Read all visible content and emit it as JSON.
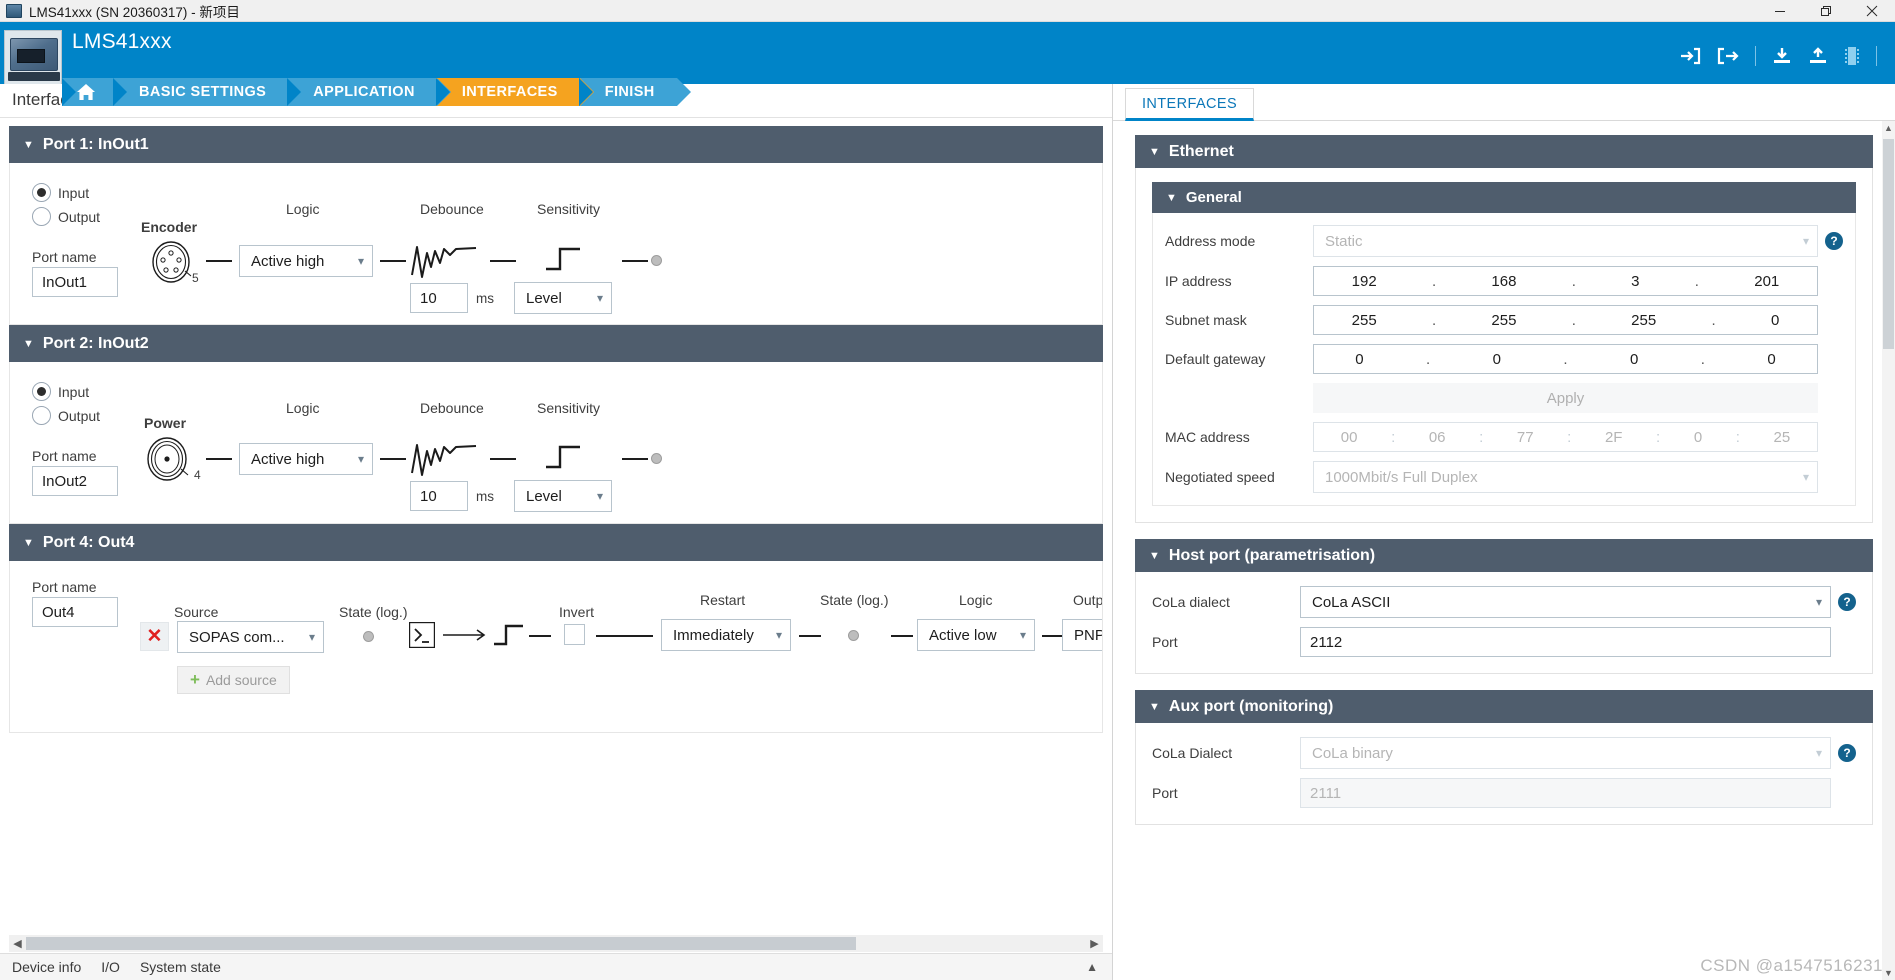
{
  "window": {
    "title": "LMS41xxx (SN 20360317) - 新项目",
    "controls": {
      "minimize": "minimize-icon",
      "restore": "restore-icon",
      "close": "close-icon"
    }
  },
  "header": {
    "device": "LMS41xxx",
    "tools": [
      "login-icon",
      "logout-icon",
      "download-icon",
      "upload-icon",
      "memory-icon"
    ],
    "nav": [
      {
        "label": "",
        "icon": "home-icon",
        "state": "normal"
      },
      {
        "label": "BASIC SETTINGS",
        "state": "normal"
      },
      {
        "label": "APPLICATION",
        "state": "normal"
      },
      {
        "label": "INTERFACES",
        "state": "active"
      },
      {
        "label": "FINISH",
        "state": "normal"
      }
    ]
  },
  "left": {
    "page_title": "Interfaces",
    "ports": [
      {
        "header": "Port 1:  InOut1",
        "direction": {
          "options": [
            "Input",
            "Output"
          ],
          "selected": "Input"
        },
        "port_name_label": "Port name",
        "port_name_value": "InOut1",
        "connector_label": "Encoder",
        "connector_pins": "5",
        "logic_label": "Logic",
        "logic_value": "Active high",
        "debounce_label": "Debounce",
        "debounce_value": "10",
        "debounce_unit": "ms",
        "sensitivity_label": "Sensitivity",
        "sensitivity_value": "Level"
      },
      {
        "header": "Port 2:  InOut2",
        "direction": {
          "options": [
            "Input",
            "Output"
          ],
          "selected": "Input"
        },
        "port_name_label": "Port name",
        "port_name_value": "InOut2",
        "connector_label": "Power",
        "connector_pins": "4",
        "logic_label": "Logic",
        "logic_value": "Active high",
        "debounce_label": "Debounce",
        "debounce_value": "10",
        "debounce_unit": "ms",
        "sensitivity_label": "Sensitivity",
        "sensitivity_value": "Level"
      }
    ],
    "port4": {
      "header": "Port 4:  Out4",
      "port_name_label": "Port name",
      "port_name_value": "Out4",
      "delete_label": "✕",
      "source_label": "Source",
      "source_value": "SOPAS com...",
      "state_label_1": "State (log.)",
      "invert_label": "Invert",
      "restart_label": "Restart",
      "restart_value": "Immediately",
      "state_label_2": "State (log.)",
      "logic_label": "Logic",
      "logic_value": "Active low",
      "output_label": "Outpu",
      "output_value": "PNP",
      "add_source_label": "Add source"
    },
    "statusbar": [
      "Device info",
      "I/O",
      "System state"
    ]
  },
  "right": {
    "tab": "INTERFACES",
    "ethernet": {
      "title": "Ethernet",
      "general": {
        "title": "General",
        "rows": [
          {
            "label": "Address mode",
            "type": "select",
            "value": "Static",
            "disabled": true,
            "help": true
          },
          {
            "label": "IP address",
            "type": "ip",
            "value": [
              "192",
              "168",
              "3",
              "201"
            ],
            "sep": ".",
            "disabled": false,
            "help": false
          },
          {
            "label": "Subnet mask",
            "type": "ip",
            "value": [
              "255",
              "255",
              "255",
              "0"
            ],
            "sep": ".",
            "disabled": false,
            "help": false
          },
          {
            "label": "Default gateway",
            "type": "ip",
            "value": [
              "0",
              "0",
              "0",
              "0"
            ],
            "sep": ".",
            "disabled": false,
            "help": false
          },
          {
            "label": "",
            "type": "button",
            "value": "Apply",
            "disabled": true,
            "help": false
          },
          {
            "label": "MAC address",
            "type": "ip",
            "value": [
              "00",
              "06",
              "77",
              "2F",
              "0",
              "25"
            ],
            "sep": ":",
            "disabled": true,
            "help": false
          },
          {
            "label": "Negotiated speed",
            "type": "select",
            "value": "1000Mbit/s Full Duplex",
            "disabled": true,
            "help": false
          }
        ]
      }
    },
    "host_port": {
      "title": "Host port (parametrisation)",
      "rows": [
        {
          "label": "CoLa dialect",
          "type": "select",
          "value": "CoLa ASCII",
          "disabled": false,
          "help": true
        },
        {
          "label": "Port",
          "type": "text",
          "value": "2112",
          "disabled": false,
          "help": false
        }
      ]
    },
    "aux_port": {
      "title": "Aux port (monitoring)",
      "rows": [
        {
          "label": "CoLa Dialect",
          "type": "select",
          "value": "CoLa binary",
          "disabled": true,
          "help": true
        },
        {
          "label": "Port",
          "type": "text",
          "value": "2111",
          "disabled": true,
          "help": false
        }
      ]
    }
  },
  "watermark": "CSDN @a1547516231",
  "colors": {
    "brand": "#0084c8",
    "accent": "#f5a31f",
    "panel": "#4f5d6d",
    "help": "#14628d"
  }
}
